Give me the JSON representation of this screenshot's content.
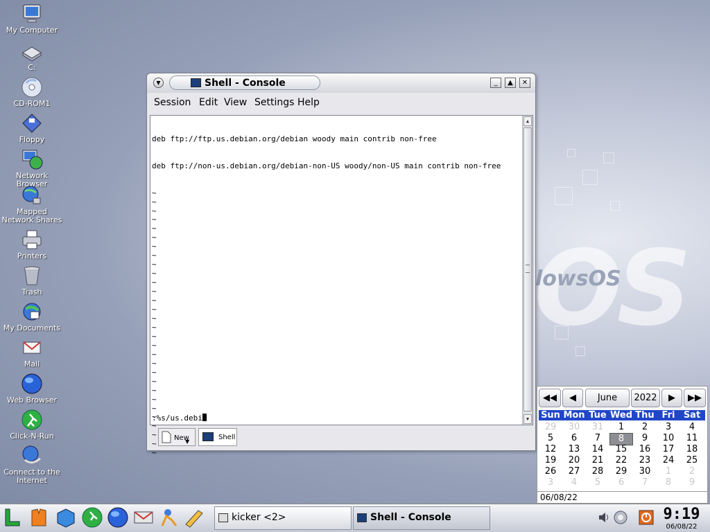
{
  "desktop": {
    "icons": [
      {
        "label": "My Computer",
        "icon": "computer-icon"
      },
      {
        "label": "C:",
        "icon": "drive-icon"
      },
      {
        "label": "CD-ROM1",
        "icon": "cdrom-icon"
      },
      {
        "label": "Floppy",
        "icon": "floppy-icon"
      },
      {
        "label": "Network Browser",
        "icon": "network-icon"
      },
      {
        "label": "Mapped Network Shares",
        "icon": "network-shares-icon"
      },
      {
        "label": "Printers",
        "icon": "printer-icon"
      },
      {
        "label": "Trash",
        "icon": "trash-icon"
      },
      {
        "label": "My Documents",
        "icon": "documents-icon"
      },
      {
        "label": "Mail",
        "icon": "mail-icon"
      },
      {
        "label": "Web Browser",
        "icon": "globe-icon"
      },
      {
        "label": "Click-N-Run",
        "icon": "runner-icon"
      },
      {
        "label": "Connect to the Internet",
        "icon": "connect-icon"
      }
    ],
    "wallpaper_text": "OS",
    "wallpaper_small": "lowsOS"
  },
  "window": {
    "title": "Shell - Console",
    "menu": [
      "Session",
      "Edit",
      "View",
      "Settings",
      "Help"
    ],
    "buttons": {
      "minimize": "_",
      "maximize": "▲",
      "close": "✕"
    },
    "terminal": {
      "lines": [
        "deb ftp://ftp.us.debian.org/debian woody main contrib non-free",
        "deb ftp://non-us.debian.org/debian-non-US woody/non-US main contrib non-free"
      ],
      "tilde": "~",
      "command": ":%s/us.debi"
    },
    "tabs": {
      "new_label": "New",
      "shell_label": "Shell"
    }
  },
  "calendar": {
    "month": "June",
    "year": "2022",
    "weekdays": [
      "Sun",
      "Mon",
      "Tue",
      "Wed",
      "Thu",
      "Fri",
      "Sat"
    ],
    "weeks": [
      [
        "29",
        "30",
        "31",
        "1",
        "2",
        "3",
        "4"
      ],
      [
        "5",
        "6",
        "7",
        "8",
        "9",
        "10",
        "11"
      ],
      [
        "12",
        "13",
        "14",
        "15",
        "16",
        "17",
        "18"
      ],
      [
        "19",
        "20",
        "21",
        "22",
        "23",
        "24",
        "25"
      ],
      [
        "26",
        "27",
        "28",
        "29",
        "30",
        "1",
        "2"
      ],
      [
        "3",
        "4",
        "5",
        "6",
        "7",
        "8",
        "9"
      ]
    ],
    "selected_day": "8",
    "date_field": "06/08/22",
    "nav": {
      "prev_year": "◀◀",
      "prev_month": "◀",
      "next_month": "▶",
      "next_year": "▶▶"
    }
  },
  "taskbar": {
    "tasks": [
      {
        "label": "kicker <2>"
      },
      {
        "label": "Shell - Console"
      }
    ],
    "clock_time": "9:19",
    "clock_date": "06/08/22"
  },
  "colors": {
    "accent": "#2046c8",
    "terminal_bg": "#ffffff"
  }
}
